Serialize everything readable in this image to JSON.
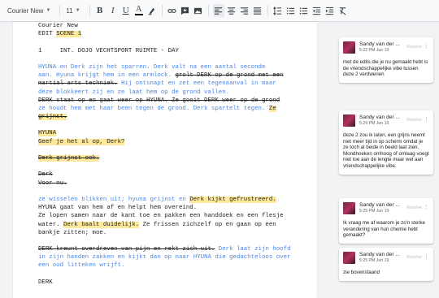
{
  "toolbar": {
    "font_name": "Courier New",
    "font_size": "11",
    "buttons": [
      "bold",
      "italic",
      "underline",
      "text-color",
      "highlight",
      "link",
      "comment",
      "image",
      "align-left",
      "align-center",
      "align-right",
      "justify",
      "line-spacing",
      "numbered-list",
      "bulleted-list",
      "decrease-indent",
      "increase-indent",
      "clear-formatting"
    ]
  },
  "doc": {
    "lines": [
      [
        {
          "t": "Courier New",
          "c": ""
        }
      ],
      [
        {
          "t": "EDIT ",
          "c": ""
        },
        {
          "t": "SCENE 1",
          "c": "hl"
        }
      ],
      [
        {
          "t": "",
          "c": ""
        }
      ],
      [
        {
          "t": "1     INT. DOJO VECHTSPORT RUIMTE - DAY",
          "c": ""
        }
      ],
      [
        {
          "t": "",
          "c": ""
        }
      ],
      [
        {
          "t": "HYUNA en Derk zijn het sparren. Derk valt na een aantal seconde",
          "c": "blue"
        }
      ],
      [
        {
          "t": "aan. Hyuna krijgt hem in een armlock. ",
          "c": "blue"
        },
        {
          "t": "grolt DERK op de grond met een",
          "c": "strike"
        }
      ],
      [
        {
          "t": "martial arts techniek.",
          "c": "strike"
        },
        {
          "t": " Hij ontsnapt en zet een tegenaanval in maar",
          "c": "blue"
        }
      ],
      [
        {
          "t": "deze blokkeert zij en ze laat hem op de grond vallen.",
          "c": "blue"
        }
      ],
      [
        {
          "t": "DERK staat op en ",
          "c": "strike"
        },
        {
          "t": "gaat",
          "c": "strike"
        },
        {
          "t": " weer op HYUNA. Ze gooit DERK weer op de grond",
          "c": "strike"
        }
      ],
      [
        {
          "t": "ze houdt hem met haar been tegen de grond. Derk spartelt tegen. ",
          "c": "blue"
        },
        {
          "t": "Ze",
          "c": "hl"
        }
      ],
      [
        {
          "t": "grijnst.",
          "c": "hl strike"
        }
      ],
      [
        {
          "t": "",
          "c": ""
        }
      ],
      [
        {
          "t": "HYUNA",
          "c": "hl"
        }
      ],
      [
        {
          "t": "Geef je het al op, Derk?",
          "c": "hl"
        }
      ],
      [
        {
          "t": "",
          "c": ""
        }
      ],
      [
        {
          "t": "Derk grijnst ook.",
          "c": "hl strike"
        }
      ],
      [
        {
          "t": "",
          "c": ""
        }
      ],
      [
        {
          "t": "Derk",
          "c": "strike"
        }
      ],
      [
        {
          "t": "Voor nu.",
          "c": "strike"
        }
      ],
      [
        {
          "t": "",
          "c": ""
        }
      ],
      [
        {
          "t": "ze wisselen blikken uit; hyuna grijnst en ",
          "c": "blue"
        },
        {
          "t": "Derk kijkt gefrustreerd.",
          "c": "hl"
        }
      ],
      [
        {
          "t": "HYUNA gaat van hem af en helpt hem overeind.",
          "c": ""
        }
      ],
      [
        {
          "t": "Ze lopen samen naar de kant toe en pakken een handdoek en een flesje",
          "c": ""
        }
      ],
      [
        {
          "t": "water. ",
          "c": ""
        },
        {
          "t": "Derk baalt duidelijk.",
          "c": "hl"
        },
        {
          "t": " Ze frissen zichzelf op en gaan op een",
          "c": ""
        }
      ],
      [
        {
          "t": "bankje zitten; moe.",
          "c": ""
        }
      ],
      [
        {
          "t": "",
          "c": ""
        }
      ],
      [
        {
          "t": "DERK kreunt overdreven van pijn en rekt zich uit.",
          "c": "strike"
        },
        {
          "t": " Derk laat zijn hoofd",
          "c": "blue"
        }
      ],
      [
        {
          "t": "in zijn handen zakken en kijkt dan op naar HYUNA die gedachteloos over",
          "c": "blue"
        }
      ],
      [
        {
          "t": "een oud litteken wrijft.",
          "c": "blue"
        }
      ],
      [
        {
          "t": "",
          "c": ""
        }
      ],
      [
        {
          "t": "DERK",
          "c": ""
        }
      ]
    ]
  },
  "comments": [
    {
      "author": "Sandy van der ...",
      "time": "5:22 PM Jun 19",
      "resolve": "Resolve",
      "body": "met de edits die je nu gemaakt hebt is de vriendschappelijke vibe tussen deze 2 verdwenen"
    },
    {
      "author": "Sandy van der ...",
      "time": "5:24 PM Jun 19",
      "resolve": "Resolve",
      "body": "deze 2 zou ik laten, een grijns neemt niet meer tijd in op scherm omdat je ze toch al beide in beeld laat zien. Mondhoeken omhoog of omlaag voegt niet toe aan de lengte maar wel aan vriendschappelijke vibe."
    },
    {
      "author": "Sandy van der ...",
      "time": "5:25 PM Jun 19",
      "resolve": "Resolve",
      "body": "Ik vraag me af waarom je zo'n sterke verandering van hun chemie hebt gemaakt?"
    },
    {
      "author": "Sandy van der ...",
      "time": "5:25 PM Jun 19",
      "resolve": "Resolve",
      "body": "zie bovenstaand"
    }
  ]
}
